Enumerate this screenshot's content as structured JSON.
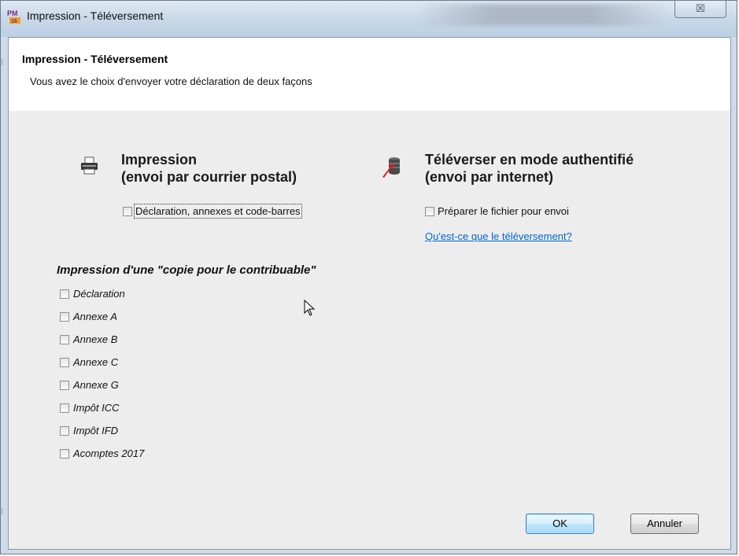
{
  "window": {
    "title": "Impression - Téléversement",
    "close_glyph": "☒"
  },
  "header": {
    "title": "Impression - Téléversement",
    "subtitle": "Vous avez le choix d'envoyer votre déclaration de deux façons"
  },
  "print_section": {
    "title_line1": "Impression",
    "title_line2": "(envoi par courrier postal)",
    "checkbox_label": "Déclaration, annexes et code-barres",
    "checked": false
  },
  "upload_section": {
    "title_line1": "Téléverser en mode authentifié",
    "title_line2": "(envoi par internet)",
    "checkbox_label": "Préparer le fichier pour envoi",
    "checked": false,
    "help_link": "Qu'est-ce que le téléversement?"
  },
  "copy_section": {
    "title": "Impression d'une \"copie pour le contribuable\"",
    "items": [
      {
        "label": "Déclaration",
        "checked": false
      },
      {
        "label": "Annexe A",
        "checked": false
      },
      {
        "label": "Annexe B",
        "checked": false
      },
      {
        "label": "Annexe C",
        "checked": false
      },
      {
        "label": "Annexe G",
        "checked": false
      },
      {
        "label": "Impôt ICC",
        "checked": false
      },
      {
        "label": "Impôt IFD",
        "checked": false
      },
      {
        "label": "Acomptes 2017",
        "checked": false
      }
    ]
  },
  "buttons": {
    "ok": "OK",
    "cancel": "Annuler"
  },
  "icons": {
    "app": "pm-app-icon",
    "printer": "printer-icon",
    "upload": "database-upload-icon",
    "cursor": "mouse-pointer-icon"
  },
  "colors": {
    "link": "#0066cc",
    "ok_button": "#bee6fd",
    "dialog_bg": "#ededed"
  }
}
